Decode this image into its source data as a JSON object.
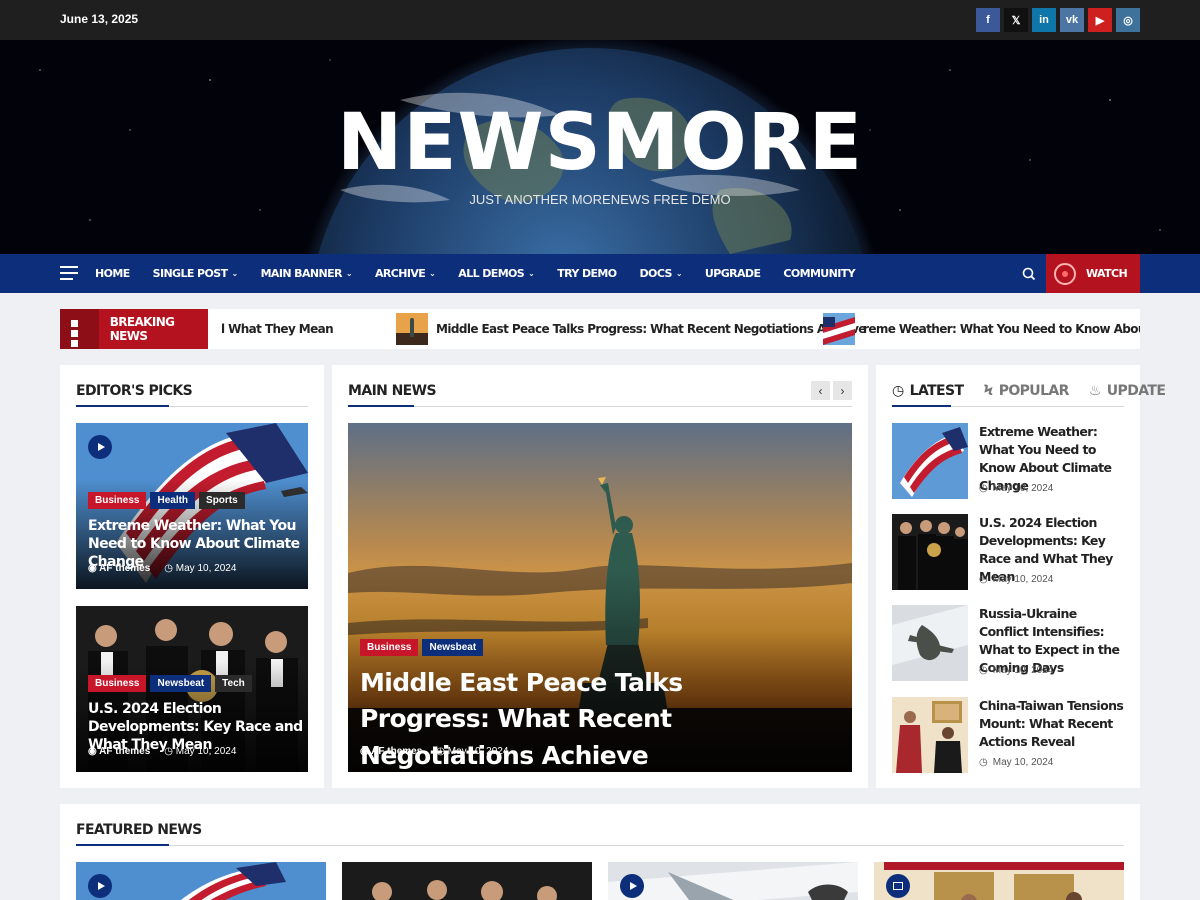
{
  "topbar": {
    "date": "June 13, 2025",
    "social": [
      {
        "icon": "facebook-icon",
        "glyph": "f",
        "color": "#3b5998"
      },
      {
        "icon": "x-icon",
        "glyph": "𝕏",
        "color": "#111111"
      },
      {
        "icon": "linkedin-icon",
        "glyph": "in",
        "color": "#0e76a8"
      },
      {
        "icon": "vk-icon",
        "glyph": "vk",
        "color": "#4c75a3"
      },
      {
        "icon": "youtube-icon",
        "glyph": "▶",
        "color": "#cd201f"
      },
      {
        "icon": "instagram-icon",
        "glyph": "◎",
        "color": "#3f729b"
      }
    ]
  },
  "hero": {
    "brand": "NEWSMORE",
    "tagline": "JUST ANOTHER MORENEWS FREE DEMO"
  },
  "nav": {
    "items": [
      {
        "label": "HOME",
        "caret": ""
      },
      {
        "label": "SINGLE POST",
        "caret": "⌄"
      },
      {
        "label": "MAIN BANNER",
        "caret": "⌄"
      },
      {
        "label": "ARCHIVE",
        "caret": "⌄"
      },
      {
        "label": "ALL DEMOS",
        "caret": "⌄"
      },
      {
        "label": "TRY DEMO",
        "caret": ""
      },
      {
        "label": "DOCS",
        "caret": "⌄"
      },
      {
        "label": "UPGRADE",
        "caret": ""
      },
      {
        "label": "COMMUNITY",
        "caret": ""
      }
    ],
    "watch_label": "WATCH"
  },
  "ticker": {
    "label": "BREAKING NEWS",
    "items": [
      {
        "text": "l What They Mean"
      },
      {
        "text": "Middle East Peace Talks Progress: What Recent Negotiations Achieve"
      },
      {
        "text": "reme Weather: What You Need to Know About Climate Change"
      }
    ]
  },
  "editors_picks": {
    "title": "EDITOR'S PICKS",
    "posts": [
      {
        "tags": [
          "Business",
          "Health",
          "Sports"
        ],
        "title": "Extreme Weather: What You Need to Know About Climate Change",
        "author": "AF themes",
        "date": "May 10, 2024"
      },
      {
        "tags": [
          "Business",
          "Newsbeat",
          "Tech"
        ],
        "title": "U.S. 2024 Election Developments: Key Race and What They Mean",
        "author": "AF themes",
        "date": "May 10, 2024"
      }
    ]
  },
  "main_news": {
    "title": "MAIN NEWS",
    "post": {
      "tags": [
        "Business",
        "Newsbeat"
      ],
      "title": "Middle East Peace Talks Progress: What Recent Negotiations Achieve",
      "author": "AF themes",
      "date": "May 10, 2024"
    }
  },
  "sidebar": {
    "tabs": [
      "LATEST",
      "POPULAR",
      "UPDATE"
    ],
    "posts": [
      {
        "title": "Extreme Weather: What You Need to Know About Climate Change",
        "date": "May 10, 2024"
      },
      {
        "title": "U.S. 2024 Election Developments: Key Race and What They Mean",
        "date": "May 10, 2024"
      },
      {
        "title": "Russia-Ukraine Conflict Intensifies: What to Expect in the Coming Days",
        "date": "May 10, 2024"
      },
      {
        "title": "China-Taiwan Tensions Mount: What Recent Actions Reveal",
        "date": "May 10, 2024"
      }
    ]
  },
  "featured": {
    "title": "FEATURED NEWS"
  },
  "colors": {
    "brand_blue": "#0d2f7b",
    "brand_red": "#b4121e"
  }
}
